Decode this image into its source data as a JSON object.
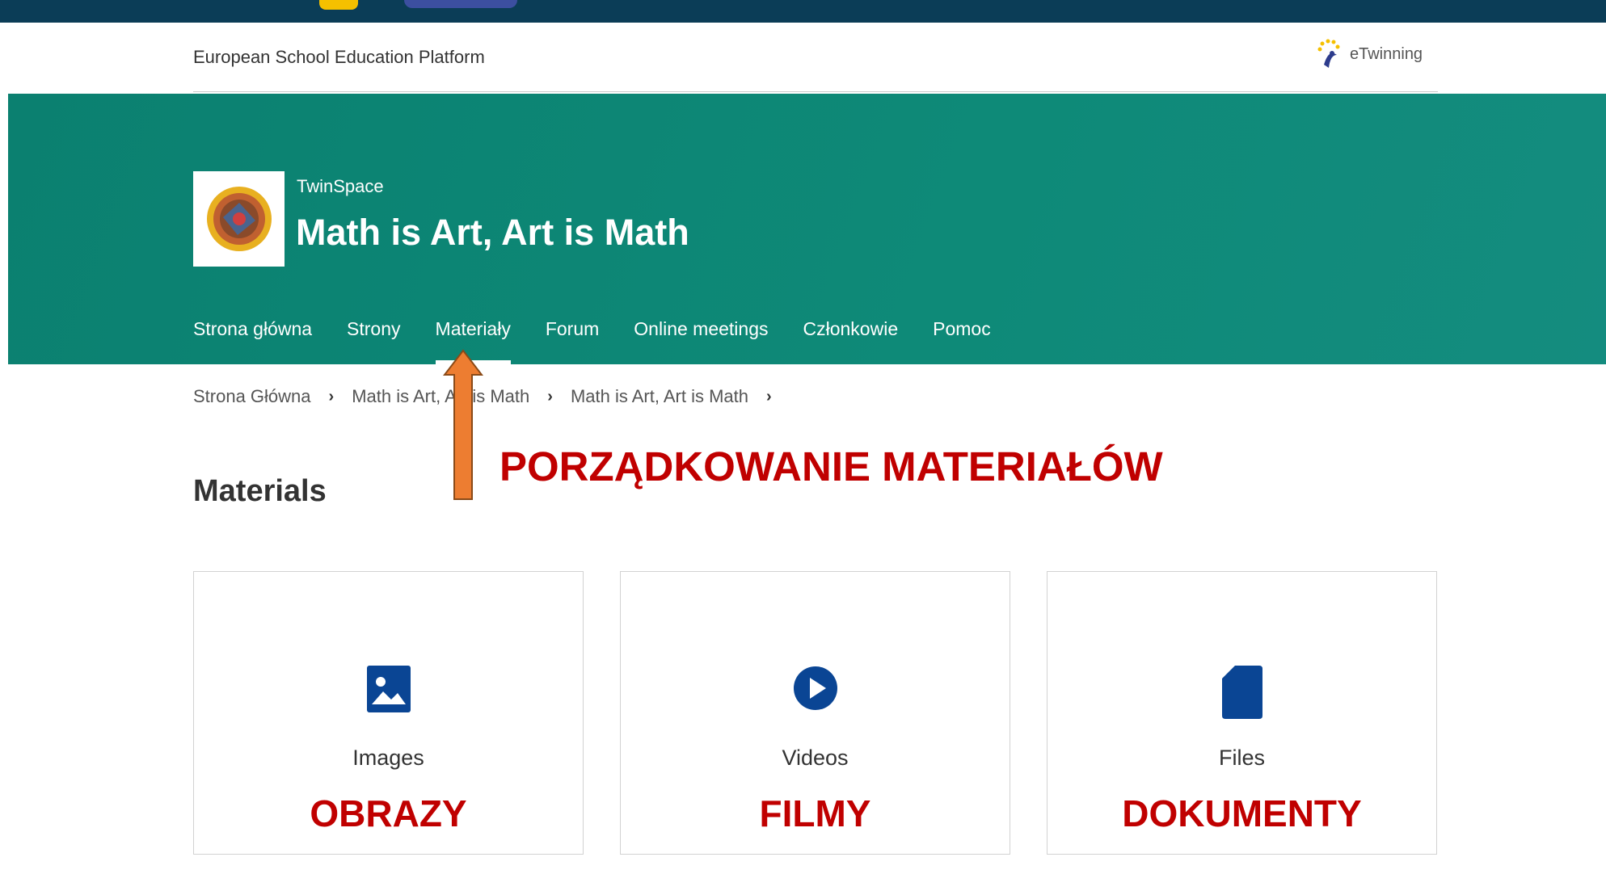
{
  "platform": {
    "name": "European School Education Platform",
    "partner_logo_text": "eTwinning"
  },
  "project": {
    "eyebrow": "TwinSpace",
    "title": "Math is Art, Art is Math"
  },
  "tabs": [
    {
      "label": "Strona główna"
    },
    {
      "label": "Strony"
    },
    {
      "label": "Materiały",
      "active": true
    },
    {
      "label": "Forum"
    },
    {
      "label": "Online meetings"
    },
    {
      "label": "Członkowie"
    },
    {
      "label": "Pomoc"
    }
  ],
  "breadcrumb": [
    {
      "label": "Strona Główna"
    },
    {
      "label": "Math is Art, Art is Math"
    },
    {
      "label": "Math is Art, Art is Math"
    }
  ],
  "annotation": {
    "text": "PORZĄDKOWANIE MATERIAŁÓW"
  },
  "section": {
    "title": "Materials"
  },
  "cards": [
    {
      "icon": "image-icon",
      "label": "Images",
      "annotation": "OBRAZY"
    },
    {
      "icon": "play-icon",
      "label": "Videos",
      "annotation": "FILMY"
    },
    {
      "icon": "file-icon",
      "label": "Files",
      "annotation": "DOKUMENTY"
    }
  ],
  "colors": {
    "banner": "#0e8a78",
    "accent_icon": "#0a4594",
    "annotation": "#c00000",
    "arrow": "#ed7d31"
  }
}
